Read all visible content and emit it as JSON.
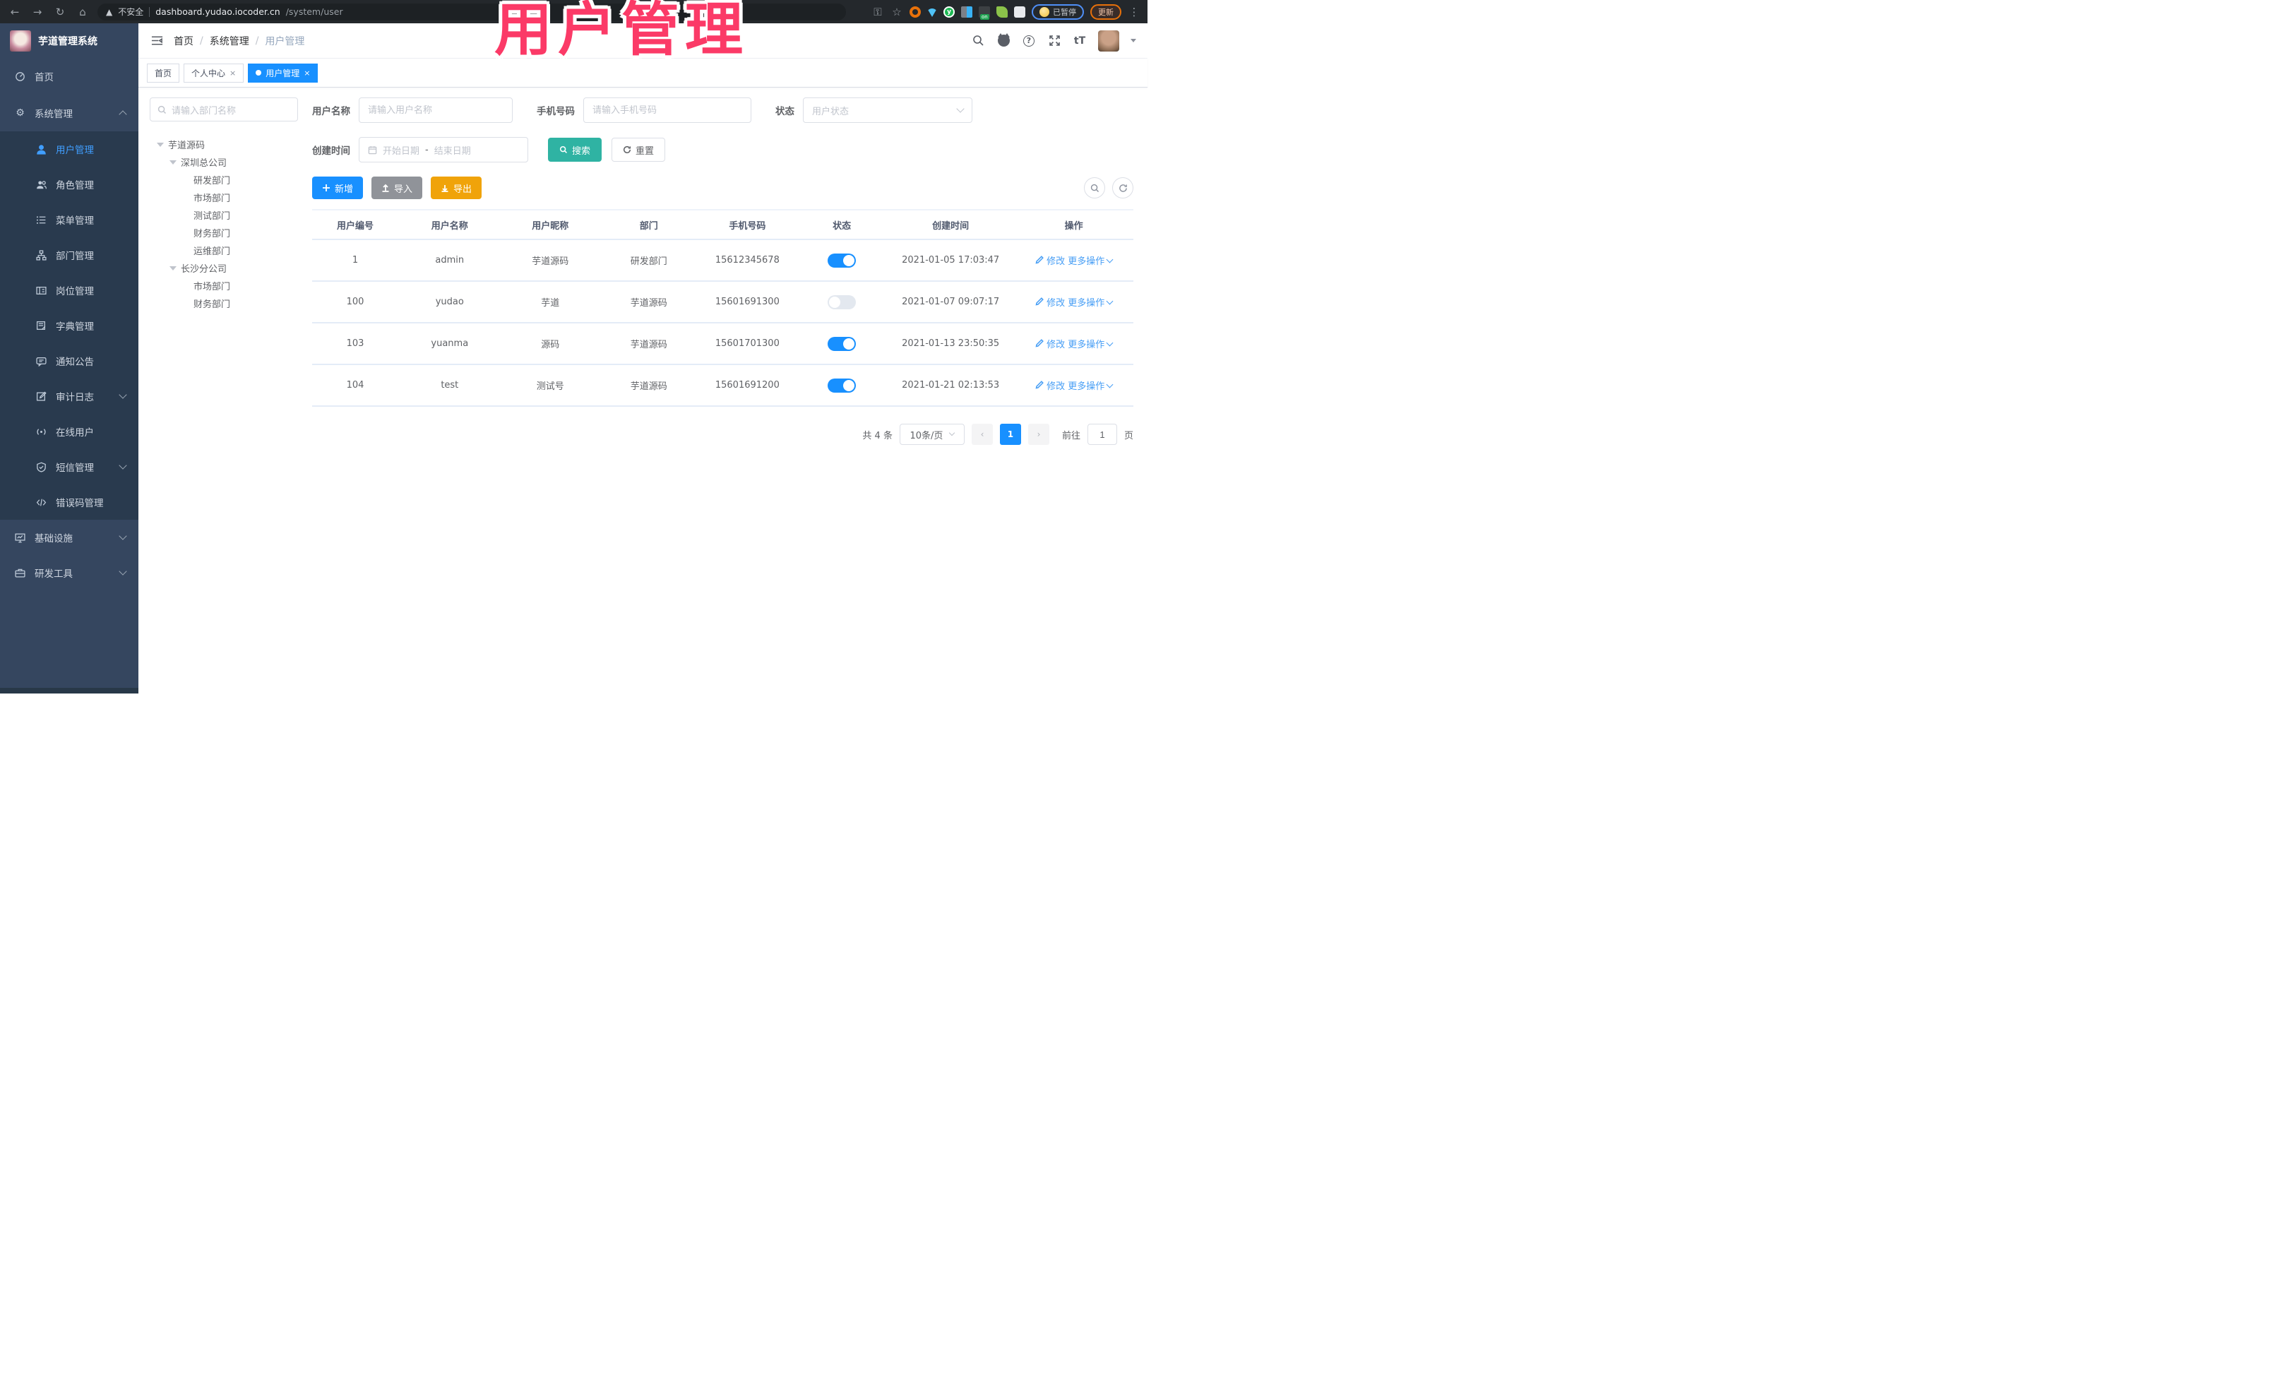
{
  "overlay_title": "用户管理",
  "browser": {
    "security_label": "不安全",
    "url_host": "dashboard.yudao.iocoder.cn",
    "url_path": "/system/user",
    "paused_label": "已暂停",
    "update_label": "更新"
  },
  "sidebar": {
    "logo_title": "芋道管理系统",
    "menu": [
      {
        "label": "首页"
      },
      {
        "label": "系统管理"
      },
      {
        "label": "基础设施"
      },
      {
        "label": "研发工具"
      }
    ],
    "submenu": [
      {
        "label": "用户管理",
        "active": true
      },
      {
        "label": "角色管理"
      },
      {
        "label": "菜单管理"
      },
      {
        "label": "部门管理"
      },
      {
        "label": "岗位管理"
      },
      {
        "label": "字典管理"
      },
      {
        "label": "通知公告"
      },
      {
        "label": "审计日志"
      },
      {
        "label": "在线用户"
      },
      {
        "label": "短信管理"
      },
      {
        "label": "错误码管理"
      }
    ]
  },
  "header": {
    "breadcrumb": [
      "首页",
      "系统管理",
      "用户管理"
    ],
    "font_size_icon_label": "tT"
  },
  "tabs": [
    {
      "label": "首页",
      "closable": false,
      "active": false
    },
    {
      "label": "个人中心",
      "closable": true,
      "active": false
    },
    {
      "label": "用户管理",
      "closable": true,
      "active": true
    }
  ],
  "tab_close_glyph": "×",
  "tree": {
    "search_placeholder": "请输入部门名称",
    "nodes": [
      {
        "label": "芋道源码"
      },
      {
        "label": "深圳总公司"
      },
      {
        "label": "研发部门"
      },
      {
        "label": "市场部门"
      },
      {
        "label": "测试部门"
      },
      {
        "label": "财务部门"
      },
      {
        "label": "运维部门"
      },
      {
        "label": "长沙分公司"
      },
      {
        "label": "市场部门"
      },
      {
        "label": "财务部门"
      }
    ]
  },
  "filters": {
    "username_label": "用户名称",
    "username_placeholder": "请输入用户名称",
    "mobile_label": "手机号码",
    "mobile_placeholder": "请输入手机号码",
    "status_label": "状态",
    "status_placeholder": "用户状态",
    "created_label": "创建时间",
    "date_start_placeholder": "开始日期",
    "date_range_separator": "-",
    "date_end_placeholder": "结束日期",
    "search_label": "搜索",
    "reset_label": "重置"
  },
  "toolbar": {
    "add_label": "新增",
    "import_label": "导入",
    "export_label": "导出"
  },
  "table": {
    "columns": [
      "用户编号",
      "用户名称",
      "用户昵称",
      "部门",
      "手机号码",
      "状态",
      "创建时间",
      "操作"
    ],
    "edit_label": "修改",
    "more_label": "更多操作",
    "rows": [
      {
        "id": "1",
        "username": "admin",
        "nickname": "芋道源码",
        "dept": "研发部门",
        "mobile": "15612345678",
        "status": "on",
        "created": "2021-01-05 17:03:47"
      },
      {
        "id": "100",
        "username": "yudao",
        "nickname": "芋道",
        "dept": "芋道源码",
        "mobile": "15601691300",
        "status": "off",
        "created": "2021-01-07 09:07:17"
      },
      {
        "id": "103",
        "username": "yuanma",
        "nickname": "源码",
        "dept": "芋道源码",
        "mobile": "15601701300",
        "status": "on",
        "created": "2021-01-13 23:50:35"
      },
      {
        "id": "104",
        "username": "test",
        "nickname": "测试号",
        "dept": "芋道源码",
        "mobile": "15601691200",
        "status": "on",
        "created": "2021-01-21 02:13:53"
      }
    ]
  },
  "pagination": {
    "total_label": "共 4 条",
    "page_size_label": "10条/页",
    "prev_glyph": "‹",
    "current_page": "1",
    "next_glyph": "›",
    "goto_label": "前往",
    "goto_value": "1",
    "page_unit_label": "页"
  },
  "colors": {
    "accent_blue": "#1890ff",
    "link_blue": "#459df5",
    "teal": "#2fb3a3",
    "amber": "#f0a30a",
    "gray_button": "#909399",
    "sidebar_bg": "#35465f",
    "submenu_bg": "#293a4e",
    "overlay_pink": "#fb3a67"
  }
}
